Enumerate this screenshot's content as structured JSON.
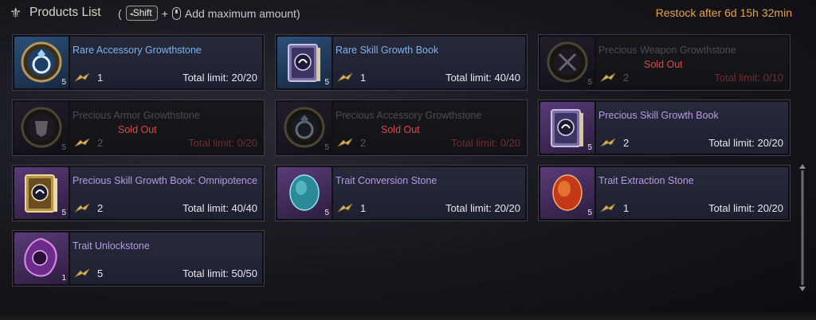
{
  "header": {
    "title": "Products List",
    "hint_open": "(",
    "shift_key": "Shift",
    "plus": "+",
    "hint_text": "Add maximum amount)",
    "restock": "Restock after 6d 15h 32min"
  },
  "sold_out_label": "Sold Out",
  "products": [
    {
      "name": "Rare Accessory Growthstone",
      "grade": "rare",
      "icon": "ring-growthstone-icon",
      "qty": "5",
      "amount": "1",
      "limit": "Total limit: 20/20",
      "sold_out": false
    },
    {
      "name": "Rare Skill Growth Book",
      "grade": "rare",
      "icon": "skill-book-icon",
      "qty": "5",
      "amount": "1",
      "limit": "Total limit: 40/40",
      "sold_out": false
    },
    {
      "name": "Precious Weapon Growthstone",
      "grade": "precious",
      "icon": "weapon-growthstone-icon",
      "qty": "5",
      "amount": "2",
      "limit": "Total limit: 0/10",
      "sold_out": true
    },
    {
      "name": "Precious Armor Growthstone",
      "grade": "precious",
      "icon": "armor-growthstone-icon",
      "qty": "5",
      "amount": "2",
      "limit": "Total limit: 0/20",
      "sold_out": true
    },
    {
      "name": "Precious Accessory Growthstone",
      "grade": "precious",
      "icon": "ring-growthstone-icon",
      "qty": "5",
      "amount": "2",
      "limit": "Total limit: 0/20",
      "sold_out": true
    },
    {
      "name": "Precious Skill Growth Book",
      "grade": "precious",
      "icon": "skill-book-icon",
      "qty": "5",
      "amount": "2",
      "limit": "Total limit: 20/20",
      "sold_out": false
    },
    {
      "name": "Precious Skill Growth Book: Omnipotence",
      "grade": "precious",
      "icon": "gold-skill-book-icon",
      "qty": "5",
      "amount": "2",
      "limit": "Total limit: 40/40",
      "sold_out": false
    },
    {
      "name": "Trait Conversion Stone",
      "grade": "precious",
      "icon": "teal-stone-icon",
      "qty": "5",
      "amount": "1",
      "limit": "Total limit: 20/20",
      "sold_out": false
    },
    {
      "name": "Trait Extraction Stone",
      "grade": "precious",
      "icon": "red-stone-icon",
      "qty": "5",
      "amount": "1",
      "limit": "Total limit: 20/20",
      "sold_out": false
    },
    {
      "name": "Trait Unlockstone",
      "grade": "precious",
      "icon": "purple-stone-icon",
      "qty": "1",
      "amount": "5",
      "limit": "Total limit: 50/50",
      "sold_out": false
    }
  ],
  "colors": {
    "accent_orange": "#e6a24a",
    "rare_name": "#7fb2ee",
    "precious_name": "#b79ae0",
    "sold_out": "#e04848"
  }
}
